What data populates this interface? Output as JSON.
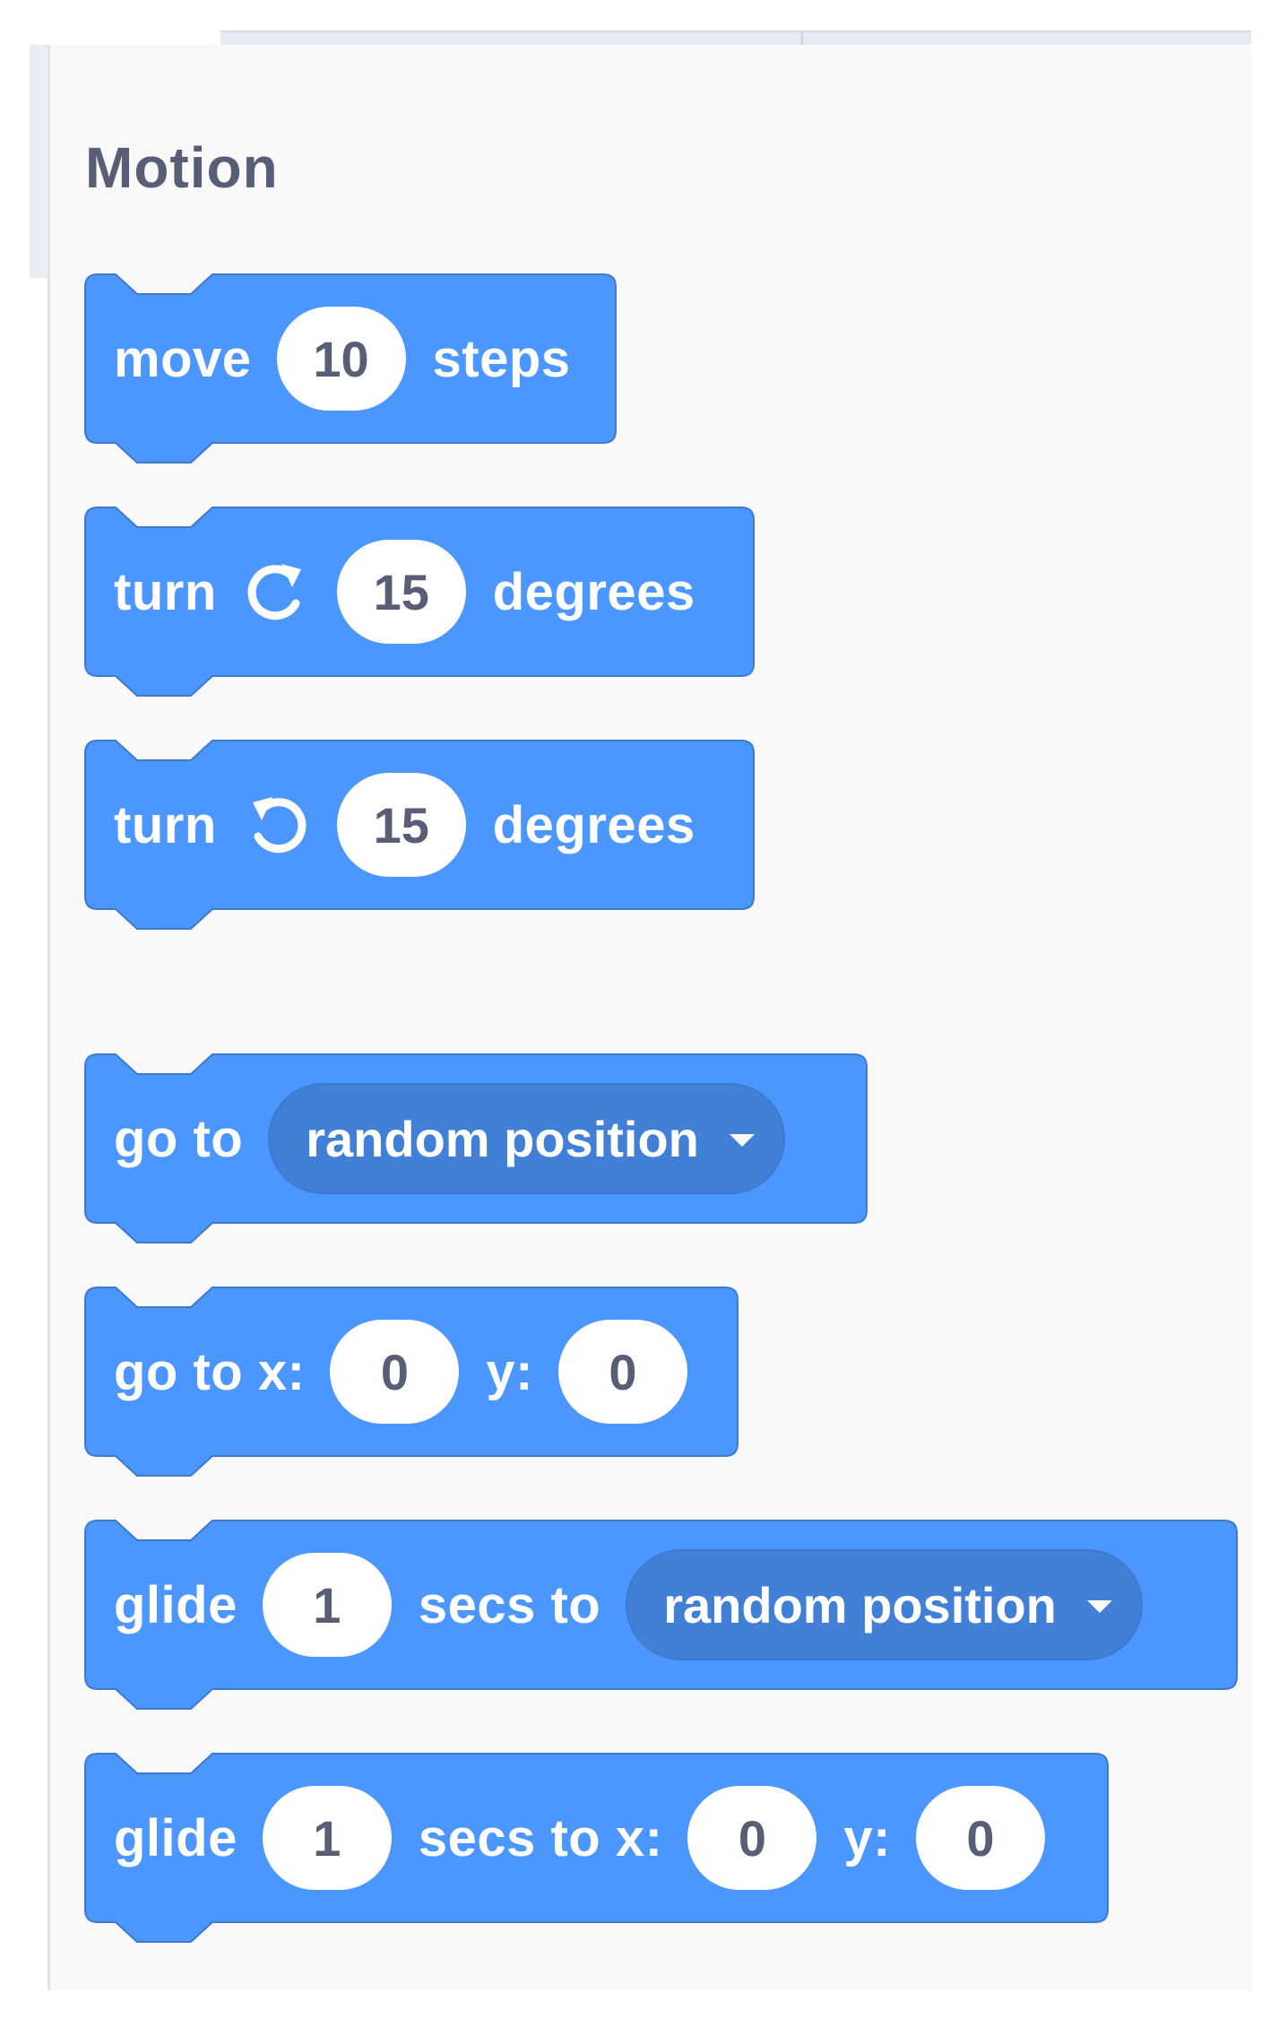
{
  "palette": {
    "category_title": "Motion",
    "colors": {
      "block": "#4c97ff",
      "block_border": "#3d79cc",
      "dropdown": "#4280d7",
      "title": "#575e75",
      "input_text": "#575e75"
    },
    "blocks": [
      {
        "parts": [
          "move",
          "10",
          "steps"
        ]
      },
      {
        "parts": [
          "turn",
          "15",
          "degrees"
        ],
        "icon": "rotate-clockwise-icon"
      },
      {
        "parts": [
          "turn",
          "15",
          "degrees"
        ],
        "icon": "rotate-counterclockwise-icon"
      },
      {
        "parts": [
          "go to",
          "random position"
        ]
      },
      {
        "parts": [
          "go to x:",
          "0",
          "y:",
          "0"
        ]
      },
      {
        "parts": [
          "glide",
          "1",
          "secs to",
          "random position"
        ]
      },
      {
        "parts": [
          "glide",
          "1",
          "secs to x:",
          "0",
          "y:",
          "0"
        ]
      }
    ]
  }
}
